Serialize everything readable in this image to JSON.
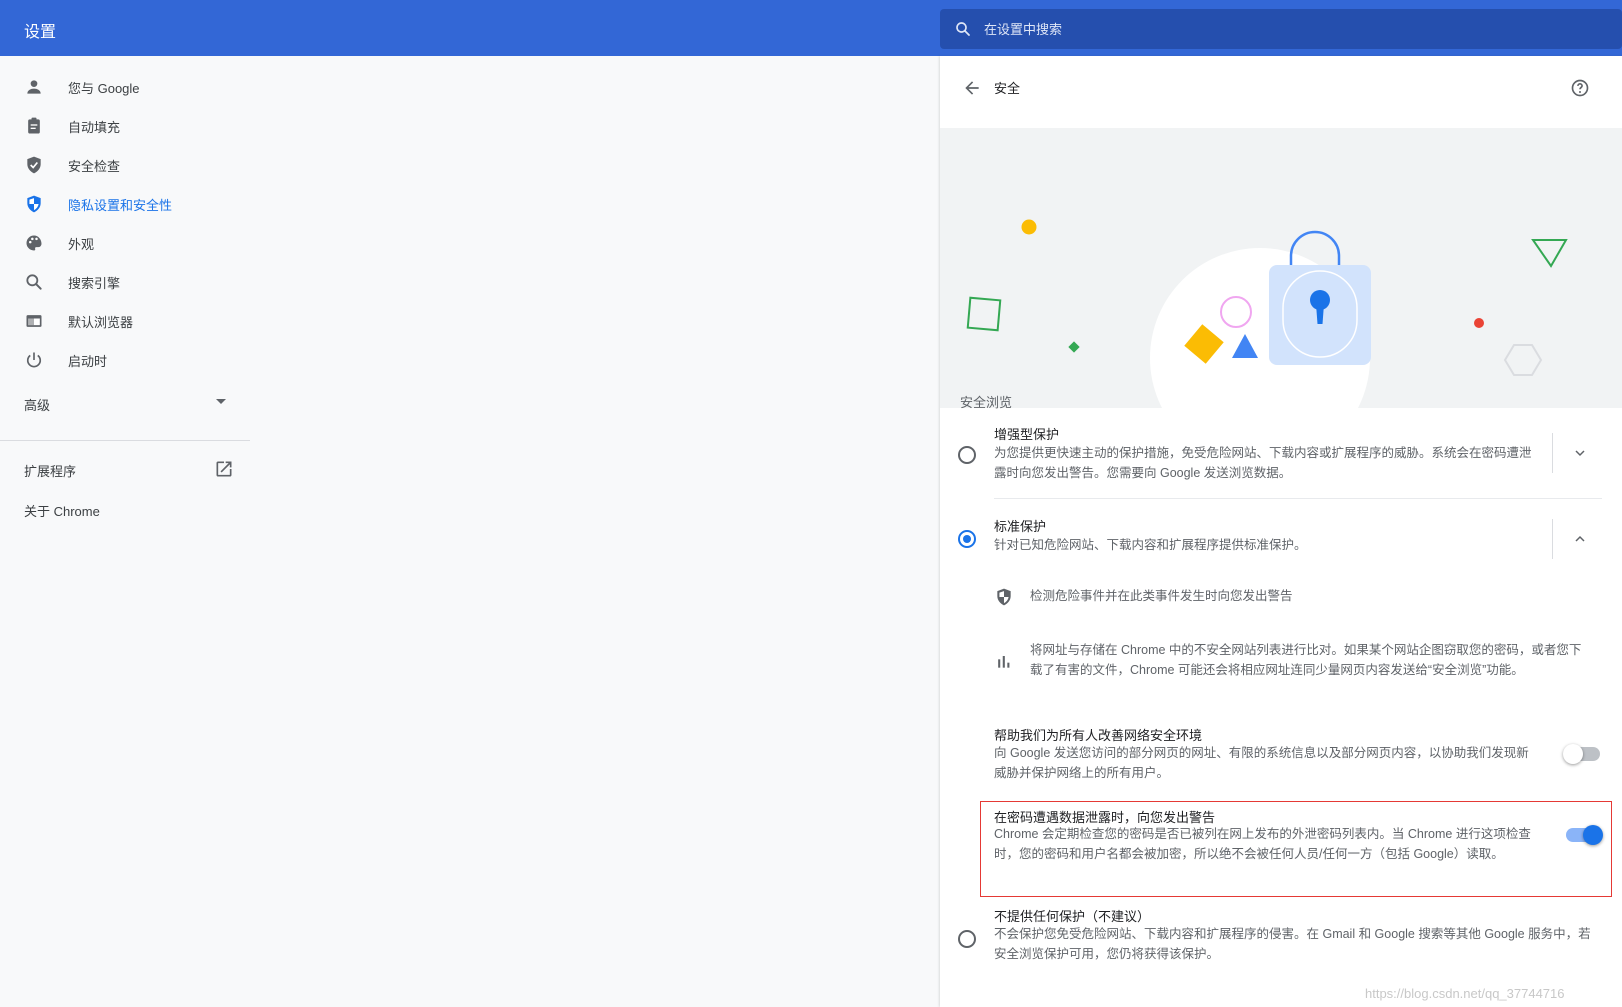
{
  "header": {
    "title": "设置"
  },
  "search": {
    "placeholder": "在设置中搜索"
  },
  "sidebar": {
    "items": [
      {
        "label": "您与 Google",
        "icon": "person-icon"
      },
      {
        "label": "自动填充",
        "icon": "clipboard-icon"
      },
      {
        "label": "安全检查",
        "icon": "shield-check-icon"
      },
      {
        "label": "隐私设置和安全性",
        "icon": "privacy-shield-icon",
        "active": true
      },
      {
        "label": "外观",
        "icon": "palette-icon"
      },
      {
        "label": "搜索引擎",
        "icon": "search-icon"
      },
      {
        "label": "默认浏览器",
        "icon": "browser-icon"
      },
      {
        "label": "启动时",
        "icon": "power-icon"
      }
    ],
    "advanced": "高级",
    "extensions": "扩展程序",
    "about": "关于 Chrome"
  },
  "page": {
    "title": "安全",
    "section": "安全浏览",
    "options": [
      {
        "title": "增强型保护",
        "desc": "为您提供更快速主动的保护措施，免受危险网站、下载内容或扩展程序的威胁。系统会在密码遭泄露时向您发出警告。您需要向 Google 发送浏览数据。",
        "checked": false
      },
      {
        "title": "标准保护",
        "desc": "针对已知危险网站、下载内容和扩展程序提供标准保护。",
        "checked": true,
        "details": [
          {
            "icon": "shield-half-icon",
            "text": "检测危险事件并在此类事件发生时向您发出警告"
          },
          {
            "icon": "bar-chart-icon",
            "text": "将网址与存储在 Chrome 中的不安全网站列表进行比对。如果某个网站企图窃取您的密码，或者您下载了有害的文件，Chrome 可能还会将相应网址连同少量网页内容发送给“安全浏览”功能。"
          }
        ],
        "toggles": [
          {
            "title": "帮助我们为所有人改善网络安全环境",
            "desc": "向 Google 发送您访问的部分网页的网址、有限的系统信息以及部分网页内容，以协助我们发现新威胁并保护网络上的所有用户。",
            "on": false
          },
          {
            "title": "在密码遭遇数据泄露时，向您发出警告",
            "desc": "Chrome 会定期检查您的密码是否已被列在网上发布的外泄密码列表内。当 Chrome 进行这项检查时，您的密码和用户名都会被加密，所以绝不会被任何人员/任何一方（包括 Google）读取。",
            "on": true
          }
        ]
      },
      {
        "title": "不提供任何保护（不建议）",
        "desc": "不会保护您免受危险网站、下载内容和扩展程序的侵害。在 Gmail 和 Google 搜索等其他 Google 服务中，若安全浏览保护可用，您仍将获得该保护。",
        "checked": false
      }
    ]
  },
  "watermark": "https://blog.csdn.net/qq_37744716",
  "colors": {
    "header": "#3367d6",
    "accent": "#1a73e8",
    "highlight": "#e53935"
  }
}
